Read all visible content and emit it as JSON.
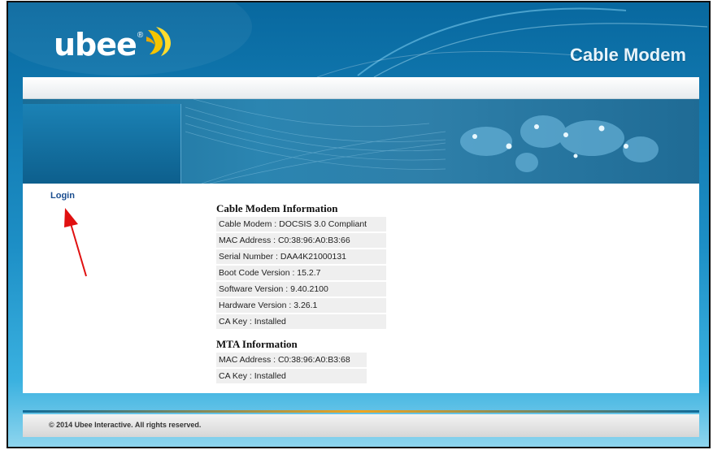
{
  "header": {
    "logo_text": "ubee",
    "logo_reg": "®",
    "product_title": "Cable Modem"
  },
  "nav": {
    "login_label": "Login"
  },
  "cable_modem_info": {
    "heading": "Cable Modem Information",
    "rows": [
      "Cable Modem : DOCSIS 3.0 Compliant",
      "MAC Address : C0:38:96:A0:B3:66",
      "Serial Number : DAA4K21000131",
      "Boot Code Version : 15.2.7",
      "Software Version : 9.40.2100",
      "Hardware Version : 3.26.1",
      "CA Key : Installed"
    ]
  },
  "mta_info": {
    "heading": "MTA Information",
    "rows": [
      "MAC Address : C0:38:96:A0:B3:68",
      "CA Key : Installed"
    ]
  },
  "footer": {
    "copyright": "© 2014 Ubee Interactive. All rights reserved."
  },
  "colors": {
    "header_blue": "#08689f",
    "accent_orange": "#f0a51f",
    "link_blue": "#1a4d8f",
    "annotation_red": "#e01010"
  }
}
